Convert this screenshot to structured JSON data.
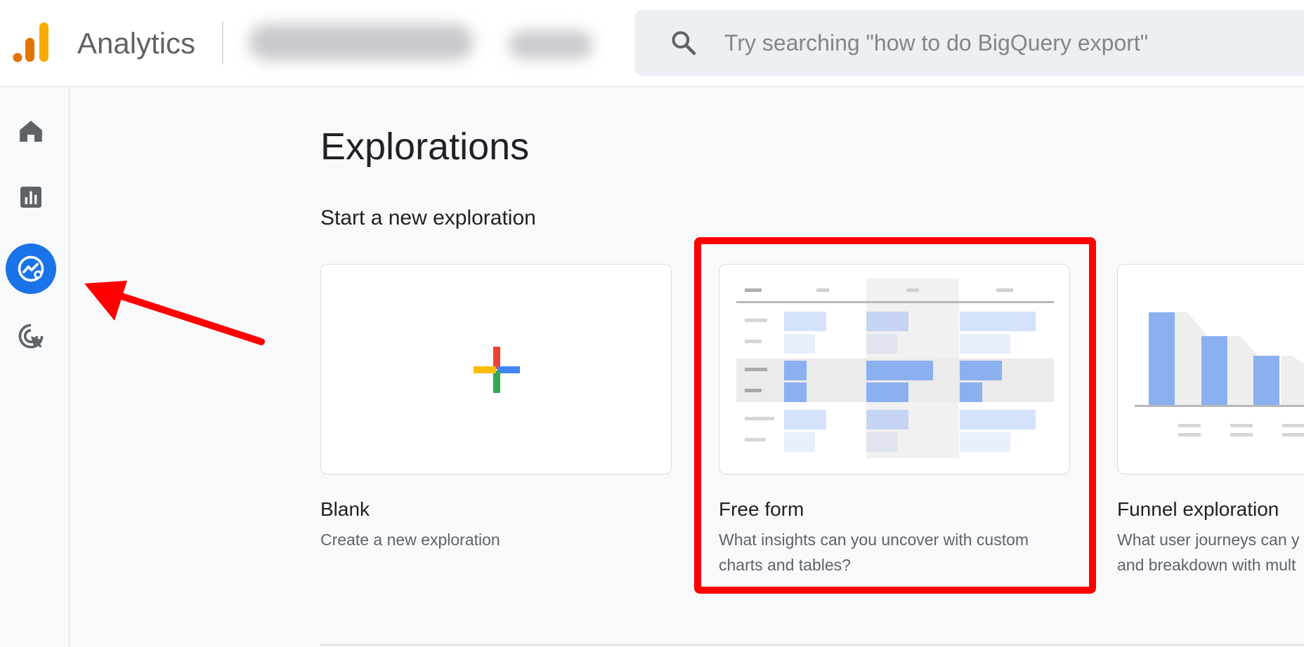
{
  "header": {
    "brand": "Analytics",
    "logo_icon": "google-analytics-logo",
    "search": {
      "icon": "search-icon",
      "placeholder": "Try searching \"how to do BigQuery export\""
    }
  },
  "sidebar": {
    "items": [
      {
        "name": "home",
        "icon": "home-icon",
        "active": false
      },
      {
        "name": "reports",
        "icon": "bar-chart-icon",
        "active": false
      },
      {
        "name": "explore",
        "icon": "explore-icon",
        "active": true
      },
      {
        "name": "advertising",
        "icon": "cursor-target-icon",
        "active": false
      }
    ]
  },
  "main": {
    "title": "Explorations",
    "section_title": "Start a new exploration",
    "cards": [
      {
        "name": "Blank",
        "description": "Create a new exploration"
      },
      {
        "name": "Free form",
        "description_line1": "What insights can you uncover with custom",
        "description_line2": "charts and tables?"
      },
      {
        "name": "Funnel exploration",
        "description_line1": "What user journeys can y",
        "description_line2": "and breakdown with mult"
      }
    ]
  },
  "annotations": {
    "highlight_color": "#ff0000",
    "arrow_color": "#ff0000"
  },
  "colors": {
    "accent": "#1a73e8",
    "plus_red": "#ea4335",
    "plus_blue": "#4285f4",
    "plus_green": "#34a853",
    "plus_yellow": "#fbbc04",
    "logo_orange": "#f9ab00",
    "logo_dark_orange": "#e37400"
  }
}
